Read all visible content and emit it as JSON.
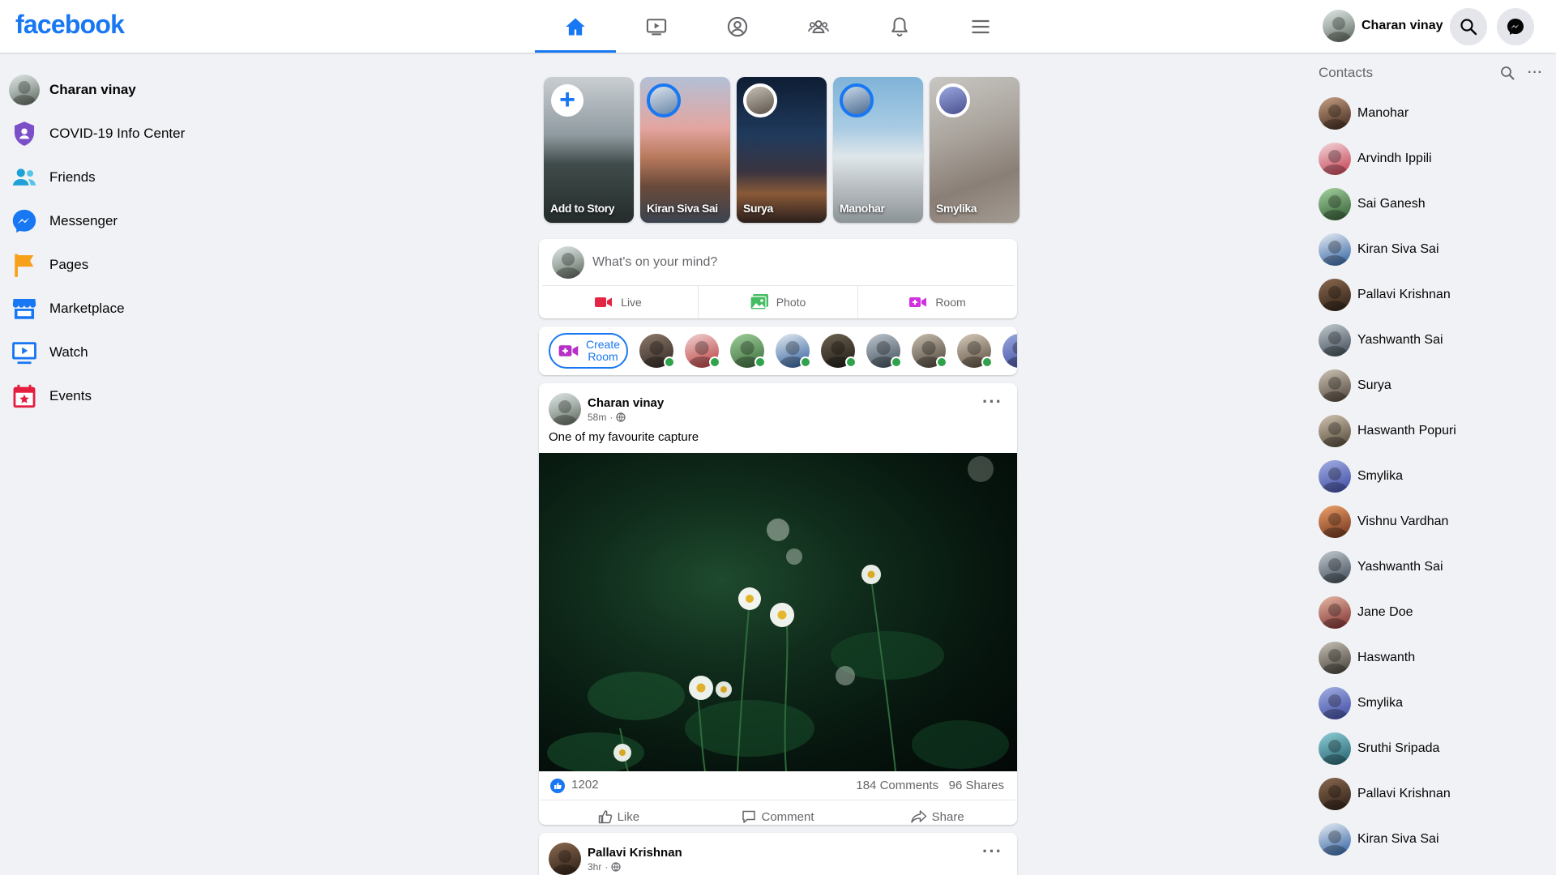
{
  "app": {
    "logo": "facebook"
  },
  "topbar": {
    "tabs": [
      {
        "name": "home",
        "icon": "home-icon",
        "active": true
      },
      {
        "name": "watch",
        "icon": "watch-icon",
        "active": false
      },
      {
        "name": "profile",
        "icon": "profile-icon",
        "active": false
      },
      {
        "name": "groups",
        "icon": "groups-icon",
        "active": false
      },
      {
        "name": "notifications",
        "icon": "bell-icon",
        "active": false
      },
      {
        "name": "menu",
        "icon": "hamburger-icon",
        "active": false
      }
    ],
    "user_name": "Charan vinay",
    "search_icon": "search-icon",
    "messenger_icon": "messenger-icon"
  },
  "sidebar": {
    "items": [
      {
        "label": "Charan vinay",
        "icon": "avatar",
        "bold": true
      },
      {
        "label": "COVID-19 Info Center",
        "icon": "shield-icon",
        "color": "#6f42c1"
      },
      {
        "label": "Friends",
        "icon": "friends-icon",
        "color": "#1ea1d6"
      },
      {
        "label": "Messenger",
        "icon": "messenger-icon",
        "color": "#1877f2"
      },
      {
        "label": "Pages",
        "icon": "flag-icon",
        "color": "#f7a11a"
      },
      {
        "label": "Marketplace",
        "icon": "store-icon",
        "color": "#1877f2"
      },
      {
        "label": "Watch",
        "icon": "watch-icon",
        "color": "#1877f2"
      },
      {
        "label": "Events",
        "icon": "calendar-icon",
        "color": "#e41e3f"
      }
    ]
  },
  "stories": [
    {
      "name": "Add to Story",
      "kind": "add"
    },
    {
      "name": "Kiran Siva Sai",
      "kind": "friend"
    },
    {
      "name": "Surya",
      "kind": "friend"
    },
    {
      "name": "Manohar",
      "kind": "friend"
    },
    {
      "name": "Smylika",
      "kind": "friend"
    }
  ],
  "composer": {
    "placeholder": "What's on your mind?",
    "actions": [
      {
        "label": "Live",
        "icon": "video-icon",
        "color": "#e42645"
      },
      {
        "label": "Photo",
        "icon": "photo-icon",
        "color": "#45bd62"
      },
      {
        "label": "Room",
        "icon": "room-icon",
        "color": "#d131e0"
      }
    ]
  },
  "rooms": {
    "create_label": "Create Room",
    "online_count": 9,
    "online_color": "#31a24c"
  },
  "post": {
    "author": "Charan vinay",
    "time": "58m",
    "privacy_icon": "globe-icon",
    "text": "One of my favourite capture",
    "likes": "1202",
    "comments": "184 Comments",
    "shares": "96 Shares",
    "actions": [
      {
        "label": "Like",
        "icon": "thumb-up-icon"
      },
      {
        "label": "Comment",
        "icon": "comment-icon"
      },
      {
        "label": "Share",
        "icon": "share-icon"
      }
    ]
  },
  "post2": {
    "author": "Pallavi Krishnan",
    "time": "3hr"
  },
  "contacts": {
    "title": "Contacts",
    "list": [
      "Manohar",
      "Arvindh Ippili",
      "Sai Ganesh",
      "Kiran Siva Sai",
      "Pallavi Krishnan",
      "Yashwanth Sai",
      "Surya",
      "Haswanth Popuri",
      "Smylika",
      "Vishnu Vardhan",
      "Yashwanth Sai",
      "Jane Doe",
      "Haswanth",
      "Smylika",
      "Sruthi Sripada",
      "Pallavi Krishnan",
      "Kiran Siva Sai"
    ]
  },
  "colors": {
    "accent": "#1877f2",
    "background": "#f0f2f5"
  }
}
